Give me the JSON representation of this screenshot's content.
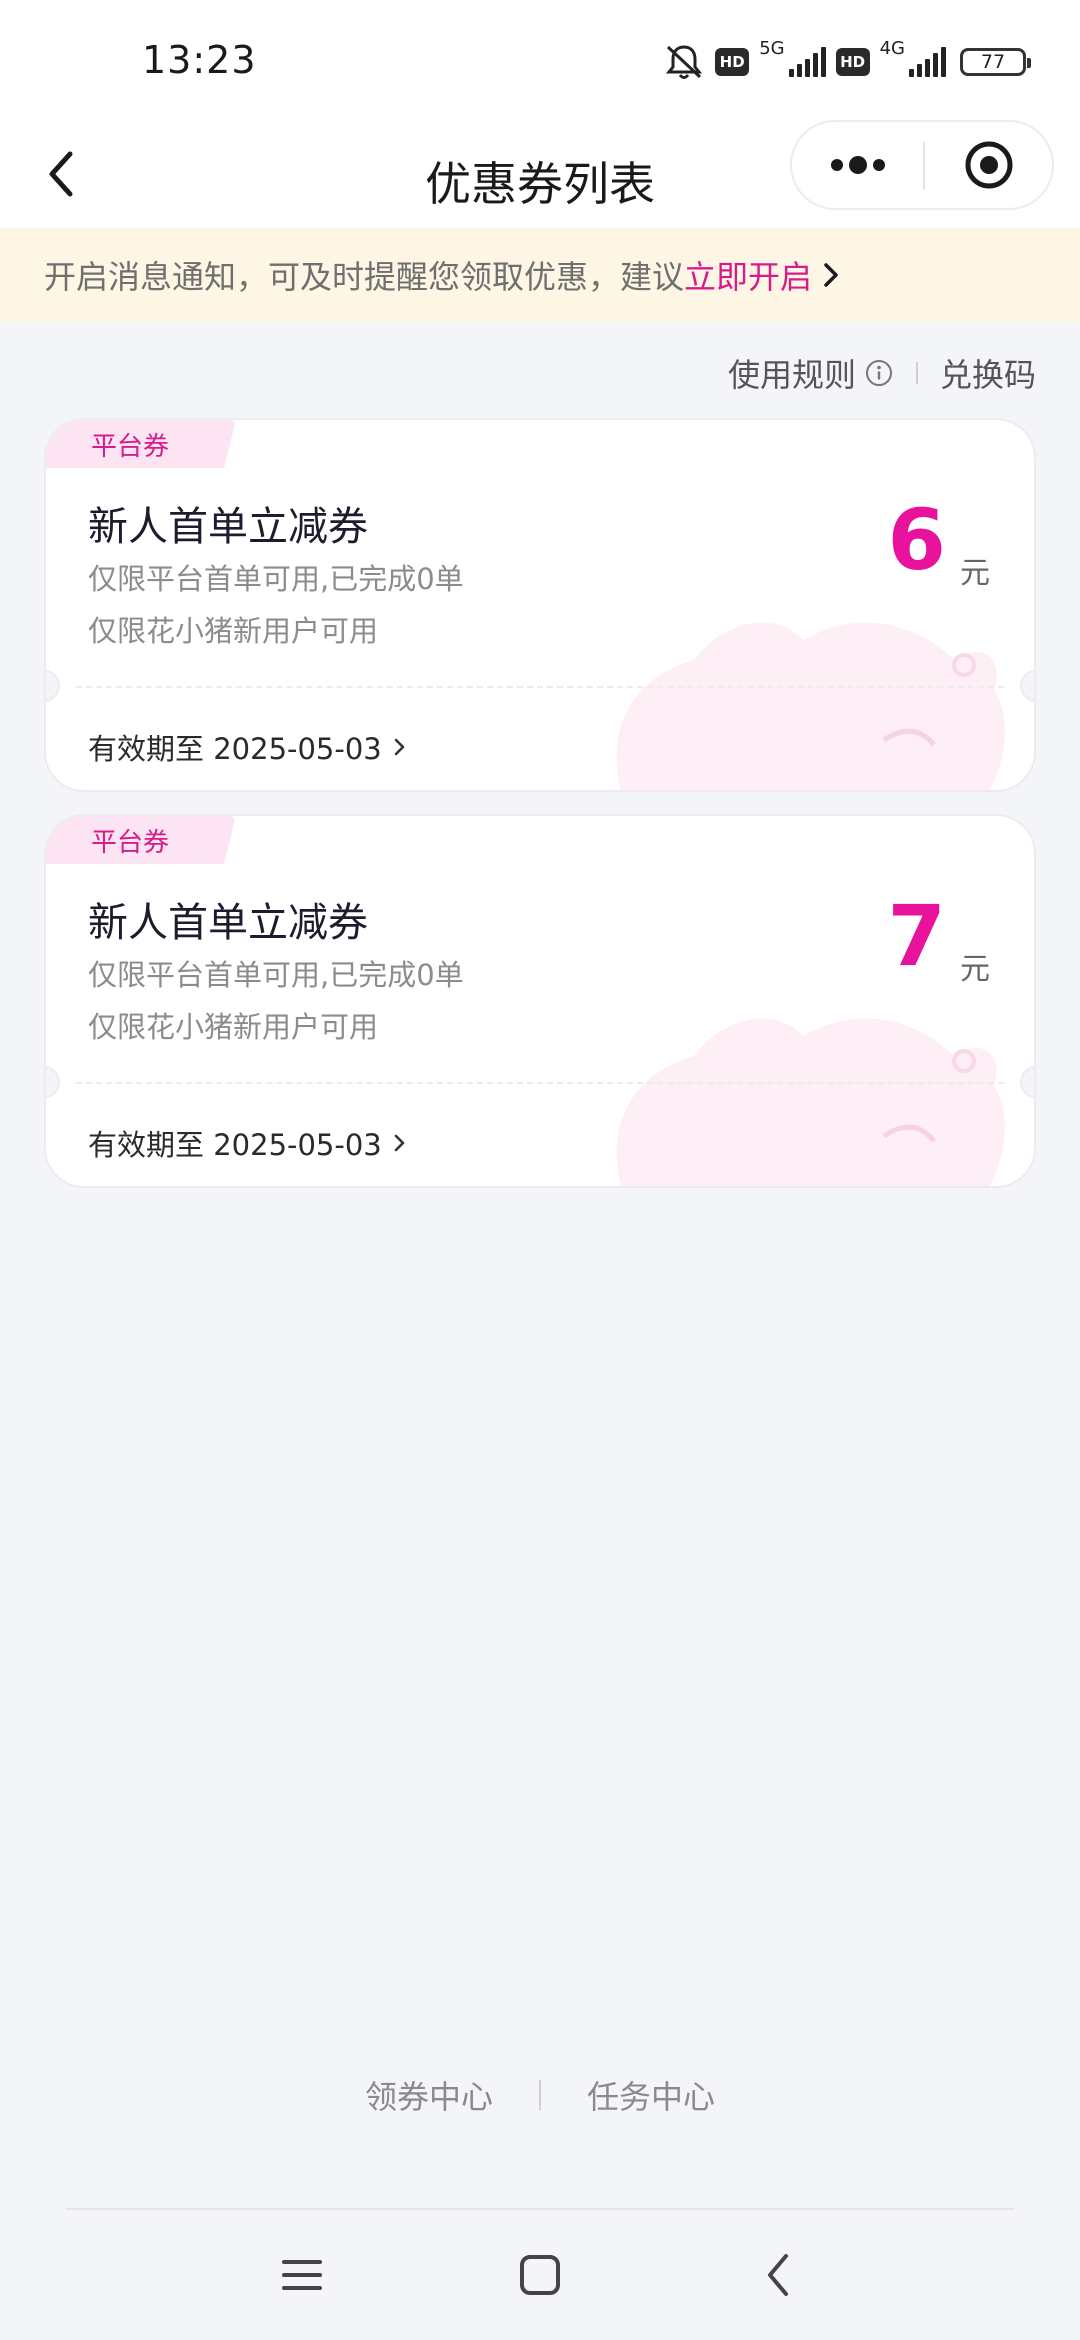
{
  "status_bar": {
    "time": "13:23",
    "network_1": "5G",
    "network_2": "4G",
    "hd_1": "HD",
    "hd_2": "HD",
    "battery": "77"
  },
  "nav": {
    "title": "优惠券列表"
  },
  "notice": {
    "text": "开启消息通知，可及时提醒您领取优惠，建议",
    "action": "立即开启"
  },
  "rules": {
    "usage_rules": "使用规则",
    "redeem_code": "兑换码"
  },
  "coupons": [
    {
      "tag": "平台券",
      "title": "新人首单立减券",
      "desc1": "仅限平台首单可用,已完成0单",
      "desc2": "仅限花小猪新用户可用",
      "amount": "6",
      "unit": "元",
      "expiry": "有效期至 2025-05-03"
    },
    {
      "tag": "平台券",
      "title": "新人首单立减券",
      "desc1": "仅限平台首单可用,已完成0单",
      "desc2": "仅限花小猪新用户可用",
      "amount": "7",
      "unit": "元",
      "expiry": "有效期至 2025-05-03"
    }
  ],
  "footer": {
    "coupon_center": "领券中心",
    "task_center": "任务中心"
  },
  "colors": {
    "accent": "#e8129c",
    "notice_bg": "#fdf6e4",
    "page_bg": "#f4f5f9"
  }
}
